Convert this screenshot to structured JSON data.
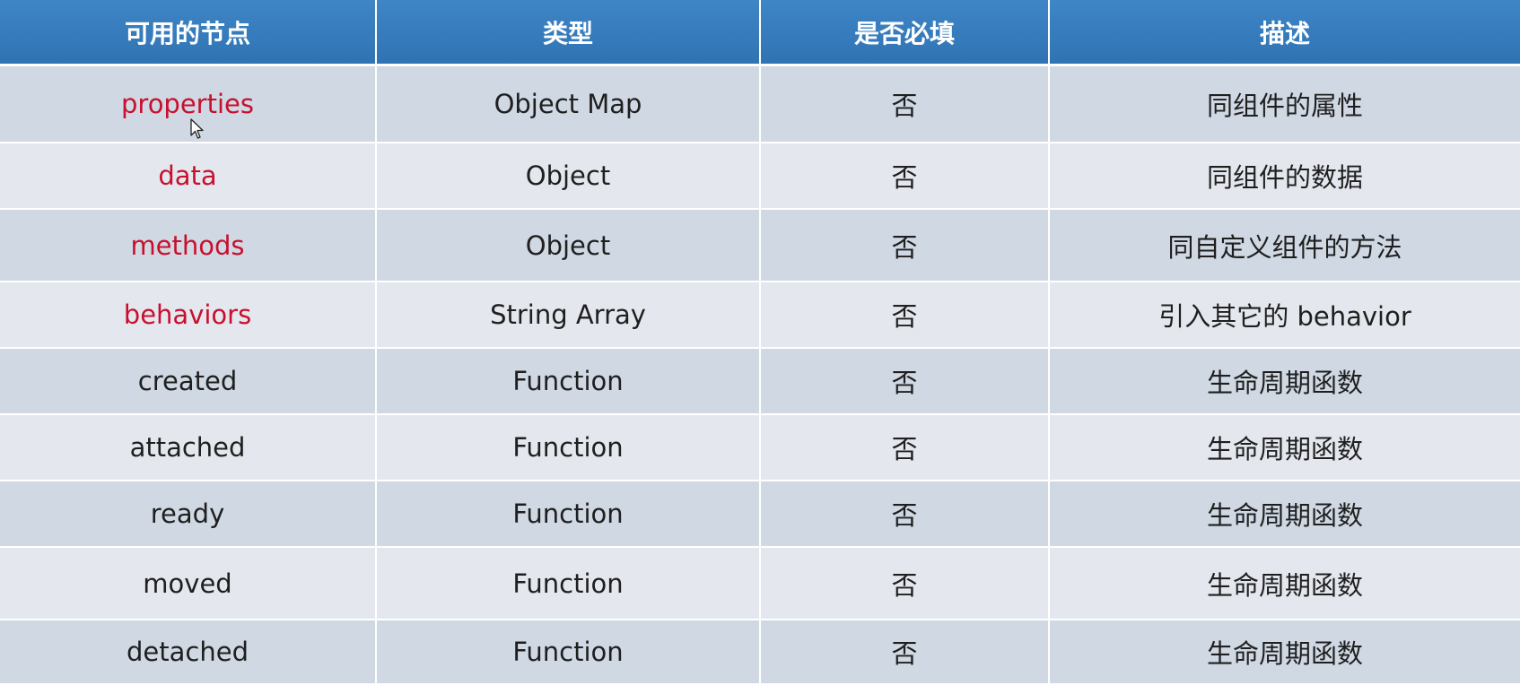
{
  "table": {
    "headers": [
      "可用的节点",
      "类型",
      "是否必填",
      "描述"
    ],
    "rows": [
      {
        "node": "properties",
        "type": "Object Map",
        "required": "否",
        "desc": "同组件的属性",
        "highlight": true
      },
      {
        "node": "data",
        "type": "Object",
        "required": "否",
        "desc": "同组件的数据",
        "highlight": true
      },
      {
        "node": "methods",
        "type": "Object",
        "required": "否",
        "desc": "同自定义组件的方法",
        "highlight": true
      },
      {
        "node": "behaviors",
        "type": "String Array",
        "required": "否",
        "desc": "引入其它的 behavior",
        "highlight": true
      },
      {
        "node": "created",
        "type": "Function",
        "required": "否",
        "desc": "生命周期函数",
        "highlight": false
      },
      {
        "node": "attached",
        "type": "Function",
        "required": "否",
        "desc": "生命周期函数",
        "highlight": false
      },
      {
        "node": "ready",
        "type": "Function",
        "required": "否",
        "desc": "生命周期函数",
        "highlight": false
      },
      {
        "node": "moved",
        "type": "Function",
        "required": "否",
        "desc": "生命周期函数",
        "highlight": false
      },
      {
        "node": "detached",
        "type": "Function",
        "required": "否",
        "desc": "生命周期函数",
        "highlight": false
      }
    ]
  },
  "colors": {
    "header_bg": "#3579b9",
    "highlight_text": "#c8102e",
    "row_dark": "#cfd8e3",
    "row_light": "#e4e8ee"
  },
  "cursor": {
    "icon": "mouse-pointer-icon"
  }
}
